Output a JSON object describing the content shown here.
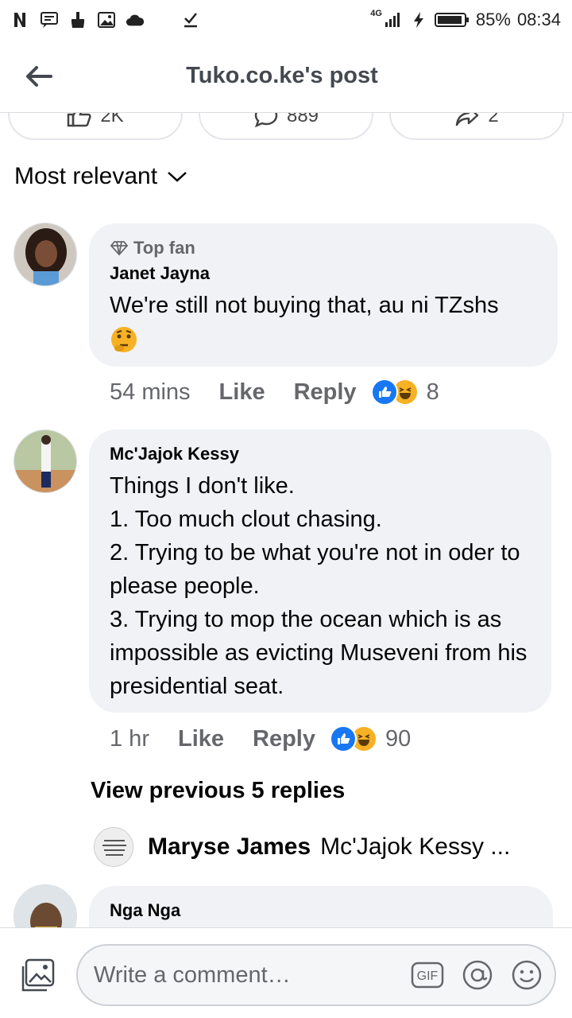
{
  "status_bar": {
    "network": "4G",
    "battery": "85%",
    "time": "08:34",
    "left_icons": [
      "netflix-icon",
      "message-icon",
      "sweep-icon",
      "image-icon",
      "cloud-icon",
      "download-check-icon"
    ]
  },
  "header": {
    "title": "Tuko.co.ke's post"
  },
  "reaction_pills": [
    {
      "icon": "like-icon",
      "label": "2K"
    },
    {
      "icon": "comment-icon",
      "label": "889"
    },
    {
      "icon": "share-icon",
      "label": "2"
    }
  ],
  "sort": {
    "label": "Most relevant"
  },
  "comments": [
    {
      "badge": "Top fan",
      "author": "Janet Jayna",
      "text": "We're still not buying that, au ni TZshs",
      "emoji": "🤔",
      "time": "54 mins",
      "like": "Like",
      "reply": "Reply",
      "reaction_count": "8"
    },
    {
      "author": "Mc'Jajok Kessy",
      "lines": [
        "Things I don't like.",
        "1. Too much clout chasing.",
        "2. Trying to be what you're not in oder to please people.",
        "3. Trying to mop the ocean which is as impossible as evicting Museveni from his presidential seat."
      ],
      "time": "1 hr",
      "like": "Like",
      "reply": "Reply",
      "reaction_count": "90"
    },
    {
      "author": "Nga Nga"
    }
  ],
  "view_previous": "View previous 5 replies",
  "reply_preview": {
    "name": "Maryse James",
    "text": "Mc'Jajok Kessy ..."
  },
  "composer": {
    "placeholder": "Write a comment…",
    "gif_label": "GIF"
  },
  "colors": {
    "bubble": "#f0f2f5",
    "secondary_text": "#65676b",
    "like_blue": "#1877f2",
    "haha_yellow": "#f7b125"
  }
}
